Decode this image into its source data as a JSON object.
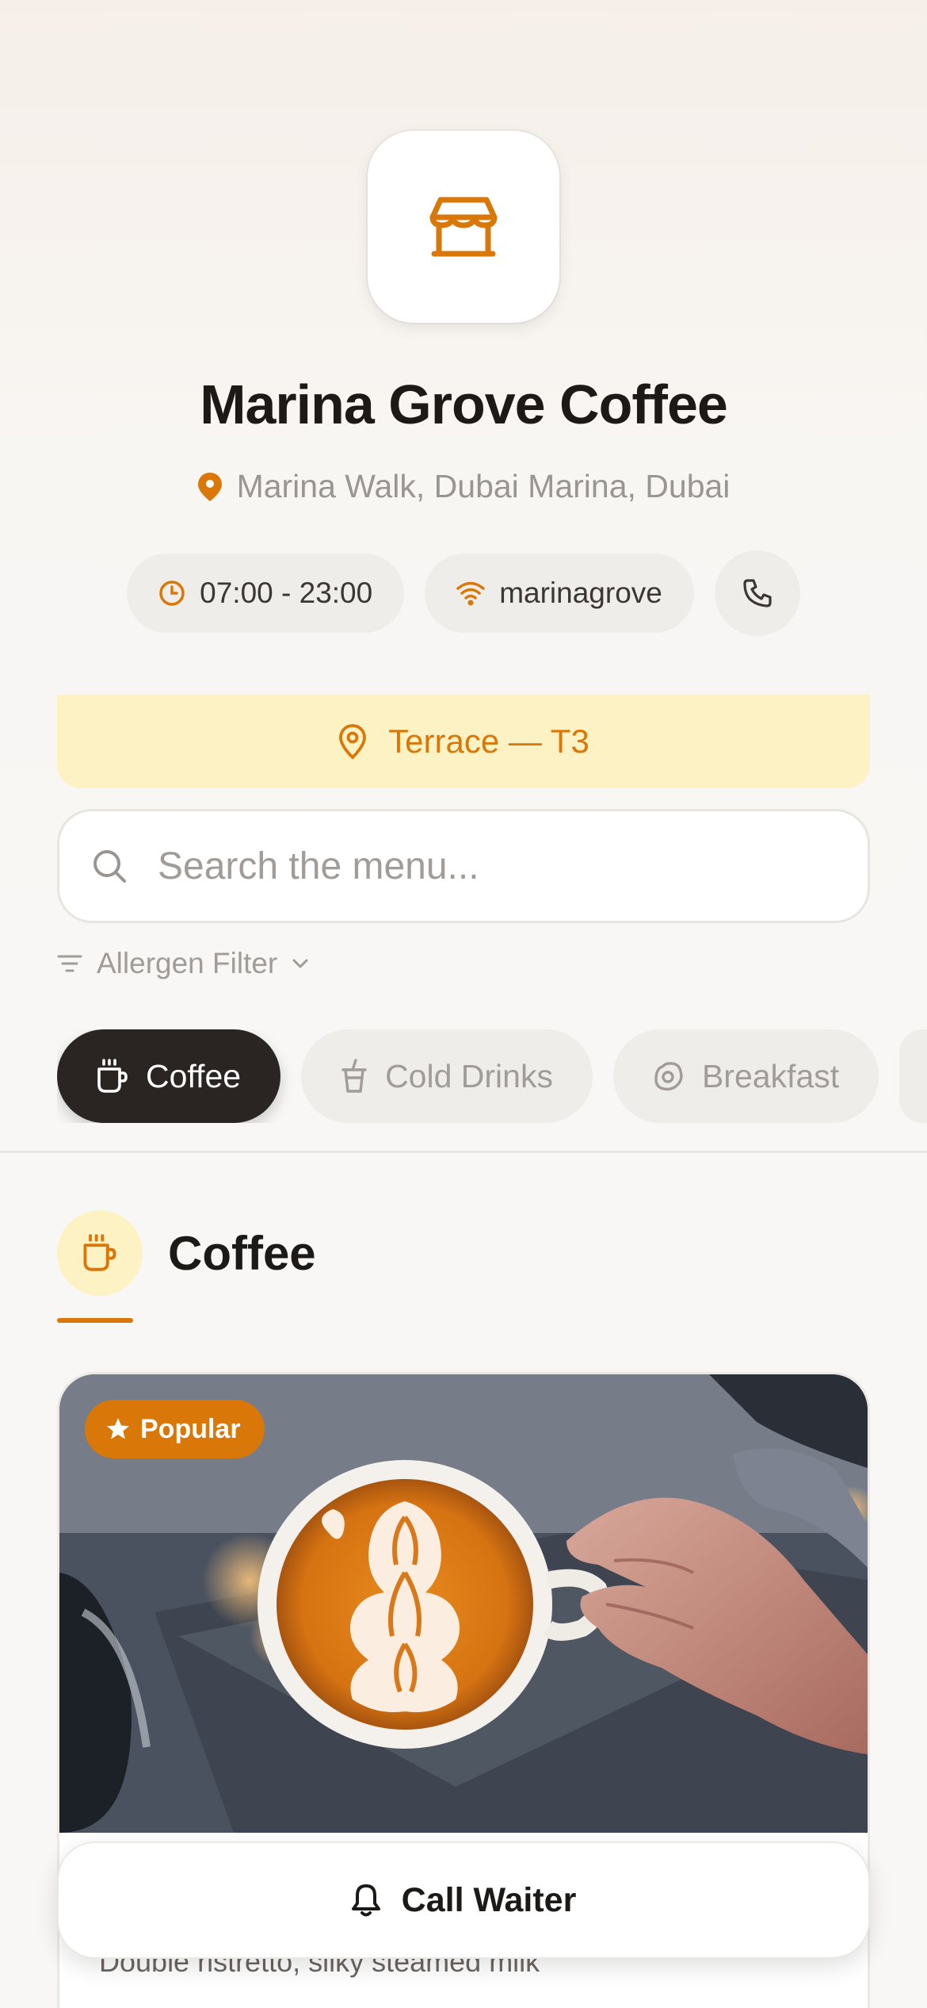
{
  "venue": {
    "name": "Marina Grove Coffee",
    "location": "Marina Walk, Dubai Marina, Dubai",
    "hours": "07:00 - 23:00",
    "wifi": "marinagrove",
    "logo_icon": "store-icon"
  },
  "table": {
    "label": "Terrace — T3"
  },
  "search": {
    "placeholder": "Search the menu..."
  },
  "allergen_filter": {
    "label": "Allergen Filter"
  },
  "categories": [
    {
      "label": "Coffee",
      "icon": "coffee-cup-icon",
      "active": true
    },
    {
      "label": "Cold Drinks",
      "icon": "cold-cup-icon",
      "active": false
    },
    {
      "label": "Breakfast",
      "icon": "egg-icon",
      "active": false
    }
  ],
  "section": {
    "title": "Coffee"
  },
  "menu_items": [
    {
      "badge": "Popular",
      "description": "Double ristretto, silky steamed milk",
      "image": "latte-art"
    }
  ],
  "actions": {
    "call_waiter": "Call Waiter"
  },
  "colors": {
    "accent": "#d97708",
    "dark": "#2a2523",
    "banner_bg": "#fdf2c4"
  }
}
